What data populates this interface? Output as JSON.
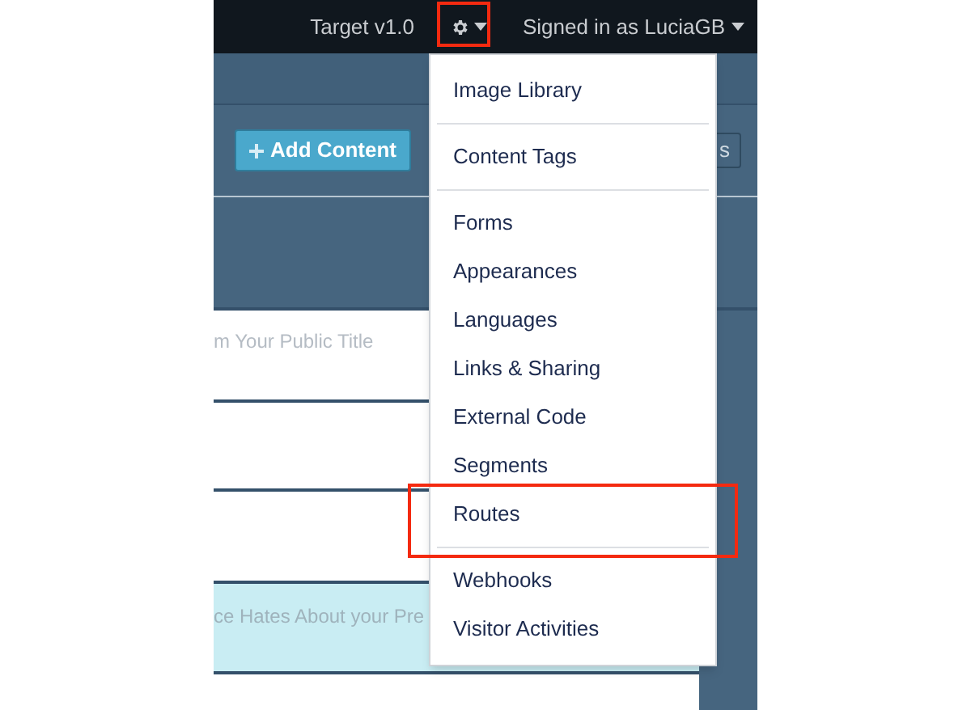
{
  "top_bar": {
    "version": "Target v1.0",
    "settings_annotated": true,
    "user_menu": "Signed in as LuciaGB"
  },
  "toolbar": {
    "add_button": "Add Content",
    "partial_button": "s"
  },
  "form": {
    "title_placeholder": "m Your Public Title",
    "highlight_placeholder": "ce Hates About your Pre"
  },
  "settings_menu": {
    "expanded": true,
    "groups": [
      [
        {
          "label": "Image Library",
          "annotated": false
        }
      ],
      [
        {
          "label": "Content Tags",
          "annotated": false
        }
      ],
      [
        {
          "label": "Forms",
          "annotated": false
        },
        {
          "label": "Appearances",
          "annotated": false
        },
        {
          "label": "Languages",
          "annotated": false
        },
        {
          "label": "Links & Sharing",
          "annotated": false
        },
        {
          "label": "External Code",
          "annotated": false
        },
        {
          "label": "Segments",
          "annotated": false
        },
        {
          "label": "Routes",
          "annotated": true
        }
      ],
      [
        {
          "label": "Webhooks",
          "annotated": false
        },
        {
          "label": "Visitor Activities",
          "annotated": false
        }
      ]
    ]
  }
}
